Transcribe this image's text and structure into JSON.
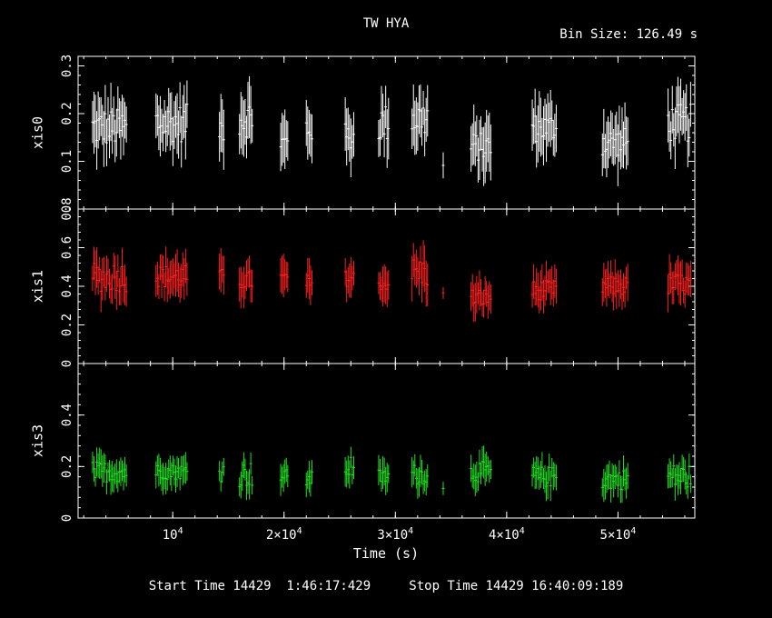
{
  "header": {
    "title": "TW HYA",
    "bin_size": "Bin Size: 126.49 s"
  },
  "footer": {
    "start_label": "Start Time 14429  1:46:17:429",
    "stop_label": "Stop Time 14429 16:40:09:189"
  },
  "colors": {
    "background": "#000000",
    "axes": "#ffffff",
    "xis0": "#ffffff",
    "xis1": "#ff2020",
    "xis3": "#20e020"
  },
  "chart_data": {
    "type": "scatter",
    "title": "TW HYA",
    "xlabel": "Time (s)",
    "xlim": [
      1500,
      56900
    ],
    "x_ticks": [
      {
        "value": 10000,
        "label": "10^4"
      },
      {
        "value": 20000,
        "label": "2×10^4"
      },
      {
        "value": 30000,
        "label": "3×10^4"
      },
      {
        "value": 40000,
        "label": "4×10^4"
      },
      {
        "value": 50000,
        "label": "5×10^4"
      }
    ],
    "panels": [
      {
        "name": "xis0",
        "ylabel": "xis0",
        "color": "#ffffff",
        "ylim": [
          0,
          0.32
        ],
        "y_ticks": [
          {
            "value": 0,
            "label": "0"
          },
          {
            "value": 0.1,
            "label": "0.1"
          },
          {
            "value": 0.2,
            "label": "0.2"
          },
          {
            "value": 0.3,
            "label": "0.3"
          }
        ],
        "segments": [
          {
            "x0": 2800,
            "x1": 5900,
            "mean": 0.17,
            "amp": 0.04,
            "err": 0.05
          },
          {
            "x0": 8500,
            "x1": 11400,
            "mean": 0.18,
            "amp": 0.04,
            "err": 0.05
          },
          {
            "x0": 14200,
            "x1": 14700,
            "mean": 0.17,
            "amp": 0.03,
            "err": 0.05
          },
          {
            "x0": 16000,
            "x1": 17300,
            "mean": 0.19,
            "amp": 0.04,
            "err": 0.05
          },
          {
            "x0": 19700,
            "x1": 20400,
            "mean": 0.14,
            "amp": 0.02,
            "err": 0.05
          },
          {
            "x0": 22000,
            "x1": 22600,
            "mean": 0.17,
            "amp": 0.03,
            "err": 0.05
          },
          {
            "x0": 25500,
            "x1": 26400,
            "mean": 0.15,
            "amp": 0.03,
            "err": 0.05
          },
          {
            "x0": 28500,
            "x1": 29500,
            "mean": 0.18,
            "amp": 0.04,
            "err": 0.05
          },
          {
            "x0": 31500,
            "x1": 33000,
            "mean": 0.19,
            "amp": 0.04,
            "err": 0.05
          },
          {
            "x0": 34300,
            "x1": 34400,
            "mean": 0.09,
            "amp": 0.01,
            "err": 0.03
          },
          {
            "x0": 36800,
            "x1": 38700,
            "mean": 0.13,
            "amp": 0.03,
            "err": 0.05
          },
          {
            "x0": 42300,
            "x1": 44600,
            "mean": 0.17,
            "amp": 0.03,
            "err": 0.05
          },
          {
            "x0": 48600,
            "x1": 51000,
            "mean": 0.14,
            "amp": 0.03,
            "err": 0.05
          },
          {
            "x0": 54500,
            "x1": 56600,
            "mean": 0.18,
            "amp": 0.04,
            "err": 0.05
          }
        ]
      },
      {
        "name": "xis1",
        "ylabel": "xis1",
        "color": "#ff2020",
        "ylim": [
          0,
          0.8
        ],
        "y_ticks": [
          {
            "value": 0,
            "label": "0"
          },
          {
            "value": 0.2,
            "label": "0.2"
          },
          {
            "value": 0.4,
            "label": "0.4"
          },
          {
            "value": 0.6,
            "label": "0.6"
          },
          {
            "value": 0.8,
            "label": "0.8"
          }
        ],
        "segments": [
          {
            "x0": 2800,
            "x1": 5900,
            "mean": 0.45,
            "amp": 0.08,
            "err": 0.09
          },
          {
            "x0": 8500,
            "x1": 11400,
            "mean": 0.45,
            "amp": 0.06,
            "err": 0.09
          },
          {
            "x0": 14200,
            "x1": 14700,
            "mean": 0.45,
            "amp": 0.04,
            "err": 0.09
          },
          {
            "x0": 16000,
            "x1": 17300,
            "mean": 0.43,
            "amp": 0.05,
            "err": 0.09
          },
          {
            "x0": 19700,
            "x1": 20400,
            "mean": 0.44,
            "amp": 0.04,
            "err": 0.09
          },
          {
            "x0": 22000,
            "x1": 22600,
            "mean": 0.41,
            "amp": 0.05,
            "err": 0.09
          },
          {
            "x0": 25500,
            "x1": 26400,
            "mean": 0.44,
            "amp": 0.04,
            "err": 0.09
          },
          {
            "x0": 28500,
            "x1": 29500,
            "mean": 0.41,
            "amp": 0.03,
            "err": 0.08
          },
          {
            "x0": 31500,
            "x1": 33000,
            "mean": 0.47,
            "amp": 0.08,
            "err": 0.1
          },
          {
            "x0": 34300,
            "x1": 34400,
            "mean": 0.36,
            "amp": 0.01,
            "err": 0.04
          },
          {
            "x0": 36800,
            "x1": 38700,
            "mean": 0.34,
            "amp": 0.05,
            "err": 0.08
          },
          {
            "x0": 42300,
            "x1": 44600,
            "mean": 0.38,
            "amp": 0.05,
            "err": 0.08
          },
          {
            "x0": 48600,
            "x1": 51000,
            "mean": 0.4,
            "amp": 0.05,
            "err": 0.08
          },
          {
            "x0": 54500,
            "x1": 56600,
            "mean": 0.41,
            "amp": 0.06,
            "err": 0.09
          }
        ]
      },
      {
        "name": "xis3",
        "ylabel": "xis3",
        "color": "#20e020",
        "ylim": [
          0,
          0.6
        ],
        "y_ticks": [
          {
            "value": 0,
            "label": "0"
          },
          {
            "value": 0.2,
            "label": "0.2"
          },
          {
            "value": 0.4,
            "label": "0.4"
          }
        ],
        "segments": [
          {
            "x0": 2800,
            "x1": 5900,
            "mean": 0.18,
            "amp": 0.04,
            "err": 0.05
          },
          {
            "x0": 8500,
            "x1": 11400,
            "mean": 0.18,
            "amp": 0.03,
            "err": 0.05
          },
          {
            "x0": 14200,
            "x1": 14700,
            "mean": 0.18,
            "amp": 0.04,
            "err": 0.05
          },
          {
            "x0": 16000,
            "x1": 17300,
            "mean": 0.17,
            "amp": 0.05,
            "err": 0.05
          },
          {
            "x0": 19700,
            "x1": 20400,
            "mean": 0.16,
            "amp": 0.03,
            "err": 0.05
          },
          {
            "x0": 22000,
            "x1": 22600,
            "mean": 0.15,
            "amp": 0.03,
            "err": 0.05
          },
          {
            "x0": 25500,
            "x1": 26400,
            "mean": 0.2,
            "amp": 0.05,
            "err": 0.05
          },
          {
            "x0": 28500,
            "x1": 29500,
            "mean": 0.16,
            "amp": 0.03,
            "err": 0.05
          },
          {
            "x0": 31500,
            "x1": 33000,
            "mean": 0.17,
            "amp": 0.04,
            "err": 0.05
          },
          {
            "x0": 34300,
            "x1": 34400,
            "mean": 0.11,
            "amp": 0.01,
            "err": 0.03
          },
          {
            "x0": 36800,
            "x1": 38700,
            "mean": 0.18,
            "amp": 0.04,
            "err": 0.05
          },
          {
            "x0": 42300,
            "x1": 44600,
            "mean": 0.16,
            "amp": 0.04,
            "err": 0.05
          },
          {
            "x0": 48600,
            "x1": 51000,
            "mean": 0.15,
            "amp": 0.04,
            "err": 0.05
          },
          {
            "x0": 54500,
            "x1": 56600,
            "mean": 0.16,
            "amp": 0.05,
            "err": 0.05
          }
        ]
      }
    ]
  }
}
